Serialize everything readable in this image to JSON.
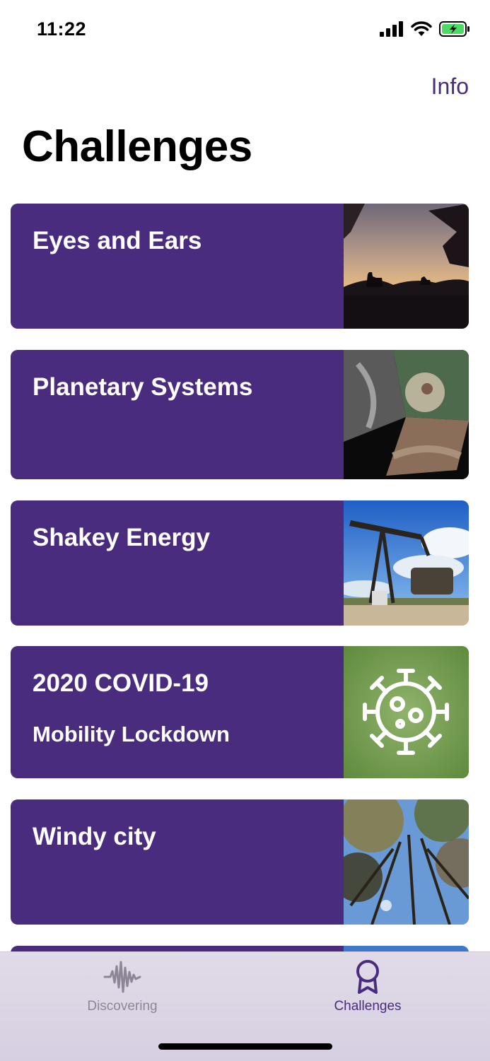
{
  "status_bar": {
    "time": "11:22"
  },
  "header": {
    "info_label": "Info",
    "title": "Challenges"
  },
  "cards": [
    {
      "title": "Eyes and Ears",
      "image": "giraffe-sunset-silhouette"
    },
    {
      "title": "Planetary Systems",
      "image": "planetary-collage"
    },
    {
      "title": "Shakey Energy",
      "image": "oil-pumpjack"
    },
    {
      "title": "2020 COVID-19",
      "subtitle": "Mobility Lockdown",
      "image": "virus-icon-green"
    },
    {
      "title": "Windy city",
      "image": "trees-looking-up"
    }
  ],
  "tab_bar": {
    "tabs": [
      {
        "label": "Discovering",
        "icon": "waveform-icon",
        "active": false
      },
      {
        "label": "Challenges",
        "icon": "award-ribbon-icon",
        "active": true
      }
    ]
  },
  "colors": {
    "accent": "#4a2c7f",
    "inactive_tab": "#8d8696",
    "tab_bar_bg": "#ddd6e5"
  }
}
